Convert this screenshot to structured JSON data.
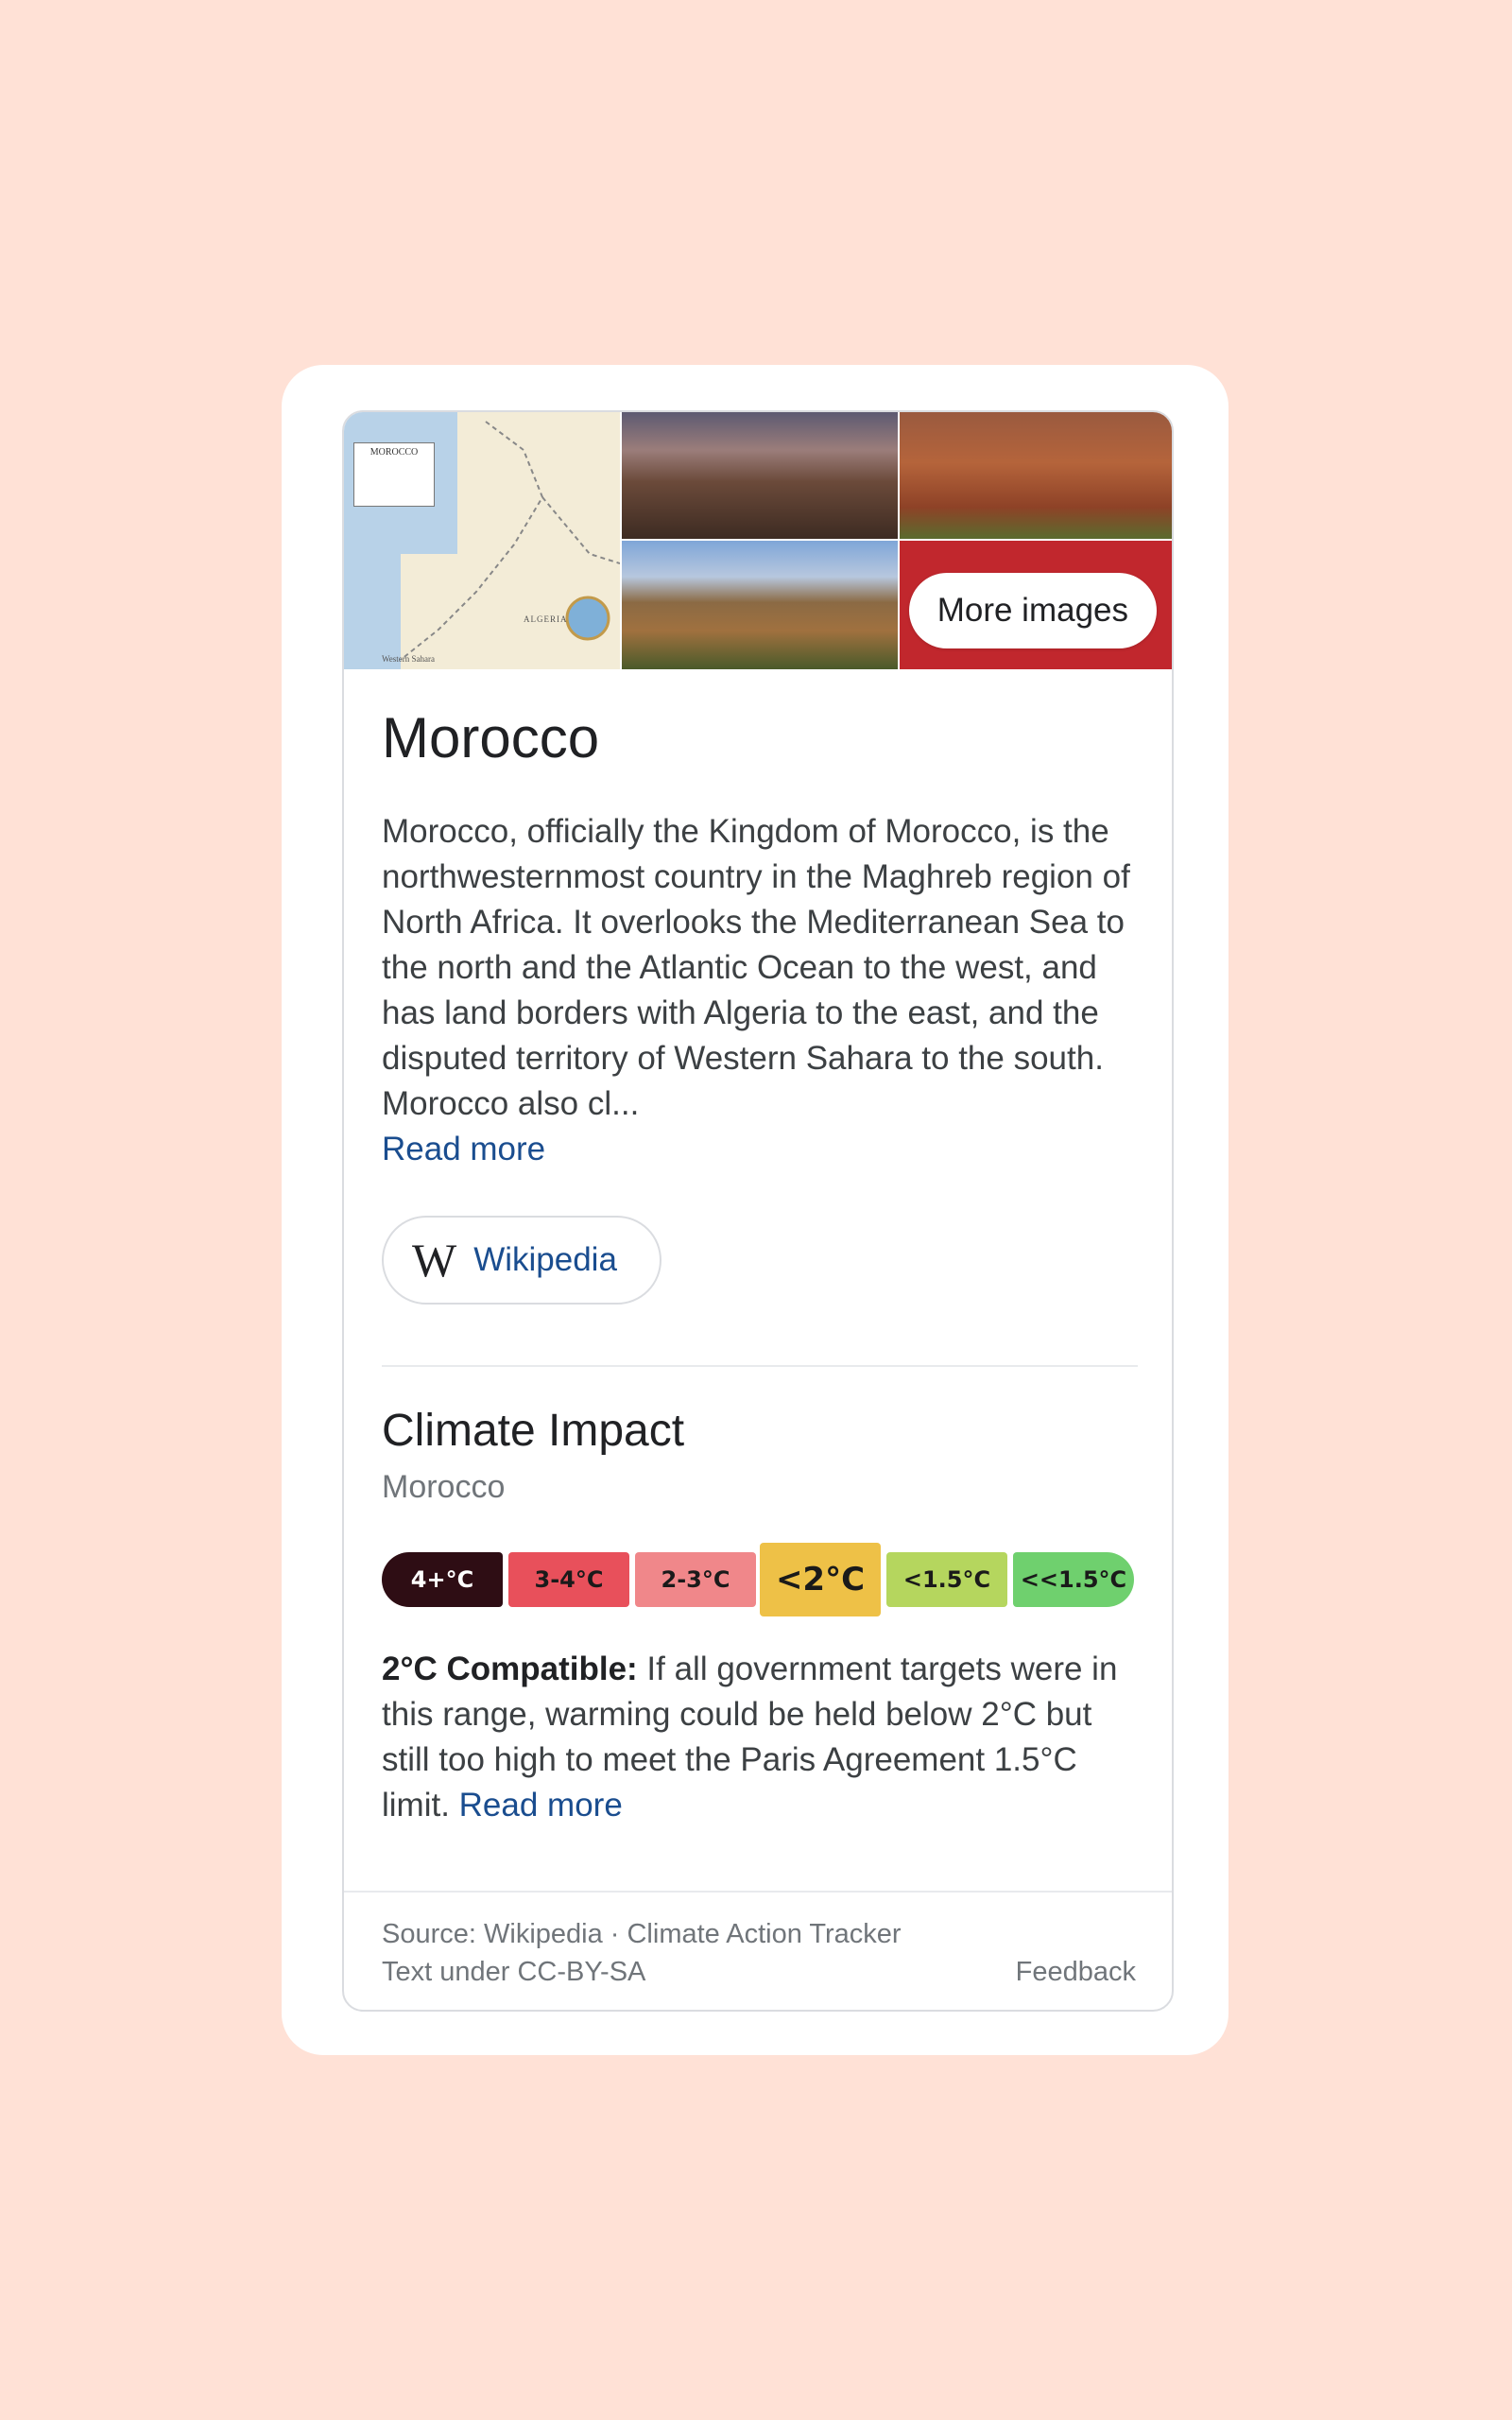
{
  "gallery": {
    "more_images_label": "More images",
    "map_label": "MOROCCO",
    "map_text_algeria": "ALGERIA",
    "map_text_western_sahara": "Western Sahara"
  },
  "entity": {
    "title": "Morocco",
    "description": "Morocco, officially the Kingdom of Morocco, is the northwesternmost country in the Maghreb region of North Africa. It overlooks the Mediterranean Sea to the north and the Atlantic Ocean to the west, and has land borders with Algeria to the east, and the disputed territory of Western Sahara to the south. Morocco also cl...",
    "read_more_label": "Read more",
    "source_button": {
      "logo": "W",
      "label": "Wikipedia"
    }
  },
  "climate": {
    "title": "Climate Impact",
    "subtitle": "Morocco",
    "scale": [
      {
        "label": "4+°C",
        "color": "#2e0d14"
      },
      {
        "label": "3-4°C",
        "color": "#e8505b"
      },
      {
        "label": "2-3°C",
        "color": "#f0878a"
      },
      {
        "label": "<2°C",
        "color": "#eec147"
      },
      {
        "label": "<1.5°C",
        "color": "#b5d65e"
      },
      {
        "label": "<<1.5°C",
        "color": "#6fd06e"
      }
    ],
    "selected_index": 3,
    "rating_label": "2°C Compatible:",
    "rating_text": " If all government targets were in this range, warming could be held below 2°C but still too high to meet the Paris Agreement 1.5°C limit. ",
    "read_more_label": "Read more"
  },
  "footer": {
    "source": "Source: Wikipedia · Climate Action Tracker",
    "license": "Text under CC-BY-SA",
    "feedback": "Feedback"
  }
}
